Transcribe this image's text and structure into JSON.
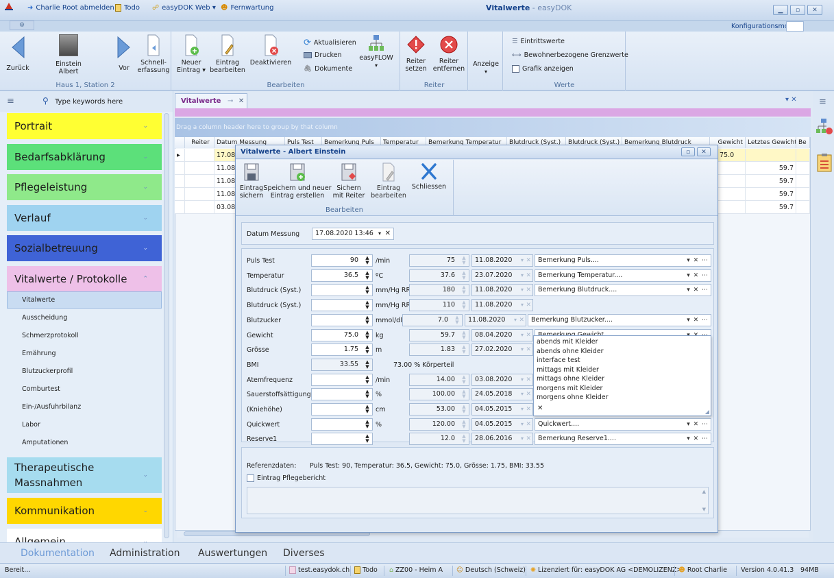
{
  "titlebar": {
    "logout": "Charlie Root abmelden",
    "todo": "Todo",
    "web": "easyDOK Web ▾",
    "remote": "Fernwartung",
    "title": "Vitalwerte",
    "app": " - easyDOK",
    "config_mode": "Konfigurationsmodus"
  },
  "ribbon": {
    "nav": {
      "back": "Zurück",
      "patient": "Einstein Albert",
      "forward": "Vor",
      "quick": "Schnell-\nerfassung",
      "group": "Haus 1, Station 2"
    },
    "edit": {
      "new": "Neuer\nEintrag ▾",
      "edit": "Eintrag\nbearbeiten",
      "deactivate": "Deaktivieren",
      "refresh": "Aktualisieren",
      "print": "Drucken",
      "documents": "Dokumente",
      "flow": "easyFLOW",
      "group": "Bearbeiten"
    },
    "tabs": {
      "set": "Reiter\nsetzen",
      "remove": "Reiter\nentfernen",
      "group": "Reiter"
    },
    "view": {
      "label": "Anzeige"
    },
    "values": {
      "entry": "Eintrittswerte",
      "limits": "Bewohnerbezogene Grenzwerte",
      "graph": "Grafik anzeigen",
      "group": "Werte"
    }
  },
  "nav": {
    "search_placeholder": "Type keywords here",
    "groups": {
      "portrait": "Portrait",
      "bedarf": "Bedarfsabklärung",
      "pflege": "Pflegeleistung",
      "verlauf": "Verlauf",
      "sozial": "Sozialbetreuung",
      "vital": "Vitalwerte / Protokolle",
      "thera": "Therapeutische Massnahmen",
      "komm": "Kommunikation",
      "allg": "Allgemein"
    },
    "sub": [
      "Vitalwerte",
      "Ausscheidung",
      "Schmerzprotokoll",
      "Ernährung",
      "Blutzuckerprofil",
      "Comburtest",
      "Ein-/Ausfuhrbilanz",
      "Labor",
      "Amputationen"
    ]
  },
  "doc_tab": {
    "label": "Vitalwerte",
    "pin": "⊸",
    "close": "✕"
  },
  "grid": {
    "group_hint": "Drag a column header here to group by that column",
    "headers": [
      "Reiter",
      "Datum Messung",
      "Puls Test",
      "Bemerkung Puls",
      "Temperatur",
      "Bemerkung Temperatur",
      "Blutdruck (Syst.)",
      "Blutdruck (Syst.)",
      "Bemerkung Blutdruck",
      "Gewicht",
      "Letztes Gewicht",
      "Be"
    ],
    "dates": [
      "17.08.",
      "11.08.",
      "11.08.",
      "11.08.",
      "03.08."
    ],
    "gewicht": [
      "75.0",
      "",
      "",
      "",
      ""
    ],
    "letztes": [
      "",
      "59.7",
      "59.7",
      "59.7",
      "59.7"
    ]
  },
  "dialog": {
    "title": "Vitalwerte - Albert Einstein",
    "toolbar": {
      "save": "Eintrag\nsichern",
      "save_new": "Speichern und neuer\nEintrag erstellen",
      "save_tab": "Sichern\nmit Reiter",
      "edit": "Eintrag\nbearbeiten",
      "close": "Schliessen",
      "group": "Bearbeiten"
    },
    "date_label": "Datum Messung",
    "date_value": "17.08.2020 13:46",
    "rows": [
      {
        "label": "Puls Test",
        "value": "90",
        "unit": "/min",
        "last": "75",
        "last_date": "11.08.2020",
        "remark": "Bemerkung Puls...."
      },
      {
        "label": "Temperatur",
        "value": "36.5",
        "unit": "ºC",
        "last": "37.6",
        "last_date": "23.07.2020",
        "remark": "Bemerkung Temperatur...."
      },
      {
        "label": "Blutdruck (Syst.)",
        "value": "",
        "unit": "mm/Hg RR",
        "last": "180",
        "last_date": "11.08.2020",
        "remark": "Bemerkung Blutdruck...."
      },
      {
        "label": "Blutdruck (Syst.)",
        "value": "",
        "unit": "mm/Hg RR",
        "last": "110",
        "last_date": "11.08.2020",
        "remark": ""
      },
      {
        "label": "Blutzucker",
        "value": "",
        "unit": "mmol/dl",
        "last": "7.0",
        "last_date": "11.08.2020",
        "remark": "Bemerkung Blutzucker...."
      },
      {
        "label": "Gewicht",
        "value": "75.0",
        "unit": "kg",
        "last": "59.7",
        "last_date": "08.04.2020",
        "remark": "Bemerkung Gewicht...."
      },
      {
        "label": "Grösse",
        "value": "1.75",
        "unit": "m",
        "last": "1.83",
        "last_date": "27.02.2020",
        "remark": ""
      },
      {
        "label": "BMI",
        "value": "33.55",
        "unit": "",
        "last": "",
        "last_date": "",
        "remark": ""
      },
      {
        "label": "Atemfrequenz",
        "value": "",
        "unit": "/min",
        "last": "14.00",
        "last_date": "03.08.2020",
        "remark": ""
      },
      {
        "label": "Sauerstoffsättigung",
        "value": "",
        "unit": "%",
        "last": "100.00",
        "last_date": "24.05.2018",
        "remark": ""
      },
      {
        "label": "(Kniehöhe)",
        "value": "",
        "unit": "cm",
        "last": "53.00",
        "last_date": "04.05.2015",
        "remark": ""
      },
      {
        "label": "Quickwert",
        "value": "",
        "unit": "%",
        "last": "120.00",
        "last_date": "04.05.2015",
        "remark": "Quickwert...."
      },
      {
        "label": "Reserve1",
        "value": "",
        "unit": "",
        "last": "12.0",
        "last_date": "28.06.2016",
        "remark": "Bemerkung Reserve1...."
      }
    ],
    "bmi_note": "73.00 % Körperteil",
    "dropdown": [
      "abends mit Kleider",
      "abends ohne Kleider",
      "interface test",
      "mittags mit Kleider",
      "mittags ohne Kleider",
      "morgens mit Kleider",
      "morgens ohne Kleider"
    ],
    "ref_label": "Referenzdaten:",
    "ref_value": "Puls Test: 90, Temperatur: 36.5, Gewicht: 75.0, Grösse: 1.75, BMI: 33.55",
    "checkbox": "Eintrag Pflegebericht"
  },
  "bottom_tabs": [
    "Dokumentation",
    "Administration",
    "Auswertungen",
    "Diverses"
  ],
  "status": {
    "ready": "Bereit...",
    "server": "test.easydok.ch",
    "todo": "Todo",
    "zone": "ZZ00 - Heim A",
    "lang": "Deutsch (Schweiz)",
    "license": "Lizenziert für: easyDOK AG <DEMOLIZENZ>",
    "user": "Root Charlie",
    "version": "Version 4.0.41.3",
    "mem": "94MB"
  },
  "colors": {
    "portrait": "#ffff33",
    "bedarf": "#5ce07a",
    "pflege": "#8fe98a",
    "verlauf": "#9fd3f0",
    "sozial": "#3f63d6",
    "vital": "#eec0e8",
    "thera": "#a6dcef",
    "komm": "#ffd700"
  }
}
